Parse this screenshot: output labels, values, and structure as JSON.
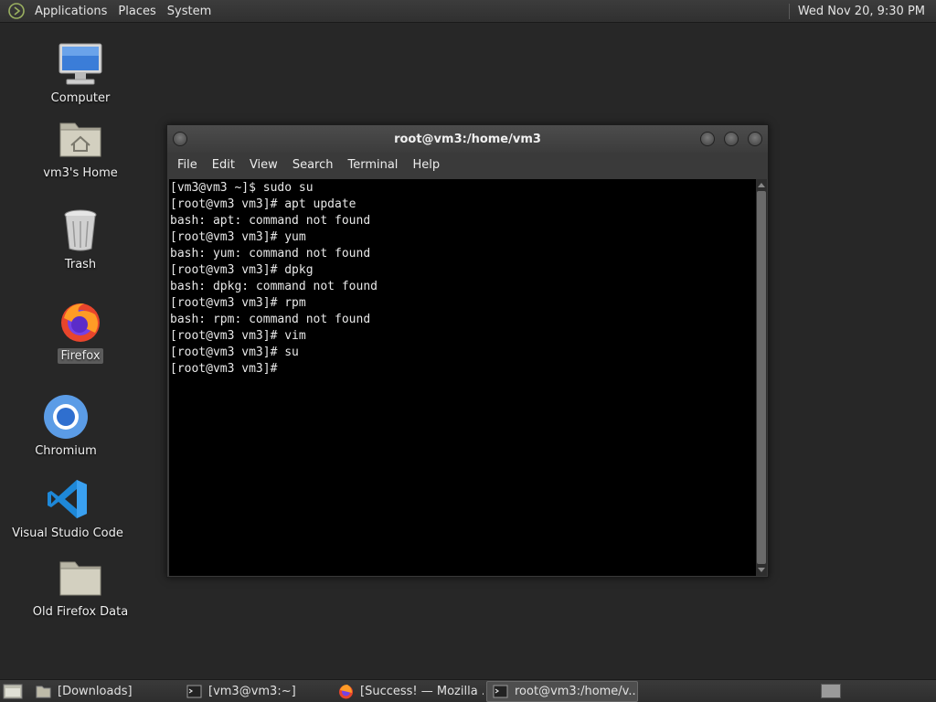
{
  "top_panel": {
    "menus": [
      "Applications",
      "Places",
      "System"
    ],
    "clock": "Wed Nov 20,  9:30 PM"
  },
  "desktop": {
    "icons": [
      {
        "label": "Computer",
        "icon": "computer-icon"
      },
      {
        "label": "vm3's Home",
        "icon": "home-folder-icon"
      },
      {
        "label": "Trash",
        "icon": "trash-icon"
      },
      {
        "label": "Firefox",
        "icon": "firefox-icon",
        "selected": true
      },
      {
        "label": "Chromium",
        "icon": "chromium-icon"
      },
      {
        "label": "Visual Studio Code",
        "icon": "vscode-icon"
      },
      {
        "label": "Old Firefox Data",
        "icon": "folder-icon"
      }
    ]
  },
  "terminal": {
    "title": "root@vm3:/home/vm3",
    "menu": [
      "File",
      "Edit",
      "View",
      "Search",
      "Terminal",
      "Help"
    ],
    "lines": [
      "[vm3@vm3 ~]$ sudo su",
      "[root@vm3 vm3]# apt update",
      "bash: apt: command not found",
      "[root@vm3 vm3]# yum",
      "bash: yum: command not found",
      "[root@vm3 vm3]# dpkg",
      "bash: dpkg: command not found",
      "[root@vm3 vm3]# rpm",
      "bash: rpm: command not found",
      "[root@vm3 vm3]# vim",
      "[root@vm3 vm3]# su",
      "[root@vm3 vm3]# "
    ]
  },
  "taskbar": {
    "tasks": [
      {
        "label": "[Downloads]",
        "icon": "folder-icon",
        "active": false
      },
      {
        "label": "[vm3@vm3:~]",
        "icon": "terminal-icon",
        "active": false
      },
      {
        "label": "[Success! — Mozilla ...",
        "icon": "firefox-icon",
        "active": false
      },
      {
        "label": "root@vm3:/home/v...",
        "icon": "terminal-icon",
        "active": true
      }
    ]
  },
  "colors": {
    "desktop_bg": "#272727",
    "panel_bg": "#333333",
    "terminal_bg": "#000000",
    "terminal_fg": "#e8e8e8"
  }
}
